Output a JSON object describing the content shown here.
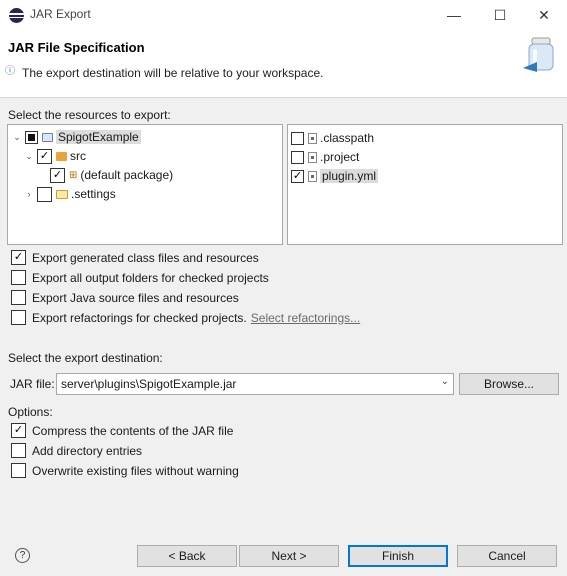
{
  "window": {
    "title": "JAR Export",
    "minimize_glyph": "—",
    "maximize_glyph": "☐",
    "close_glyph": "✕"
  },
  "header": {
    "title": "JAR File Specification",
    "message": "The export destination will be relative to your workspace.",
    "info_glyph": "ⓘ"
  },
  "resources": {
    "label": "Select the resources to export:",
    "tree": [
      {
        "label": "SpigotExample",
        "state": "partial",
        "expanded": true,
        "icon": "project-icon",
        "selected": true
      },
      {
        "label": "src",
        "state": "checked",
        "expanded": true,
        "icon": "source-folder-icon"
      },
      {
        "label": "(default package)",
        "state": "checked",
        "icon": "package-icon"
      },
      {
        "label": ".settings",
        "state": "unchecked",
        "expanded": false,
        "icon": "folder-icon"
      }
    ],
    "files": [
      {
        "label": ".classpath",
        "state": "unchecked"
      },
      {
        "label": ".project",
        "state": "unchecked"
      },
      {
        "label": "plugin.yml",
        "state": "checked",
        "selected": true
      }
    ]
  },
  "export_options": [
    {
      "label": "Export generated class files and resources",
      "checked": true
    },
    {
      "label": "Export all output folders for checked projects",
      "checked": false
    },
    {
      "label": "Export Java source files and resources",
      "checked": false
    },
    {
      "label": "Export refactorings for checked projects.",
      "checked": false,
      "link": "Select refactorings..."
    }
  ],
  "destination": {
    "label": "Select the export destination:",
    "jar_label": "JAR file:",
    "jar_value": "server\\plugins\\SpigotExample.jar",
    "browse_label": "Browse..."
  },
  "options": {
    "label": "Options:",
    "items": [
      {
        "label": "Compress the contents of the JAR file",
        "checked": true
      },
      {
        "label": "Add directory entries",
        "checked": false
      },
      {
        "label": "Overwrite existing files without warning",
        "checked": false
      }
    ]
  },
  "footer": {
    "help_glyph": "?",
    "back_label": "< Back",
    "next_label": "Next >",
    "finish_label": "Finish",
    "cancel_label": "Cancel"
  },
  "colors": {
    "accent": "#0078d7",
    "link": "#6a6a6a",
    "selection": "#dcdcdc"
  }
}
